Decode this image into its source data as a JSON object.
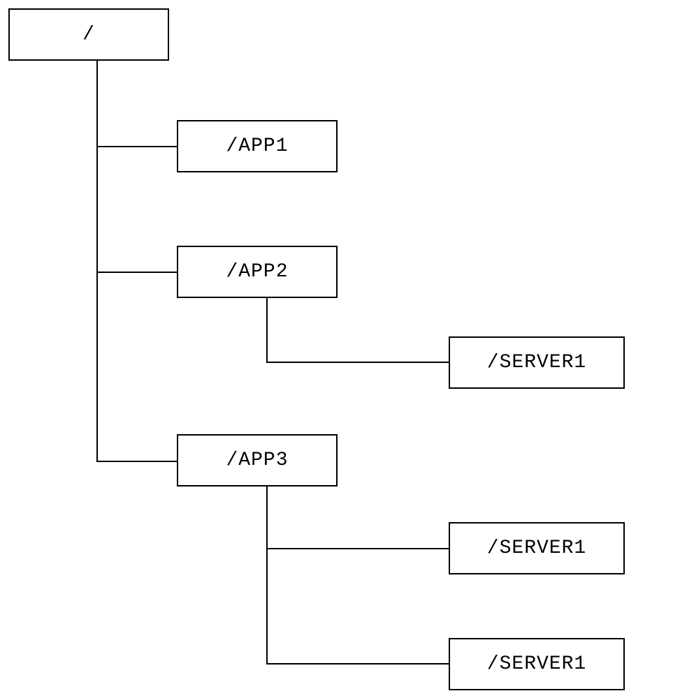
{
  "diagram": {
    "root": {
      "label": "/"
    },
    "level1": {
      "app1": {
        "label": "/APP1"
      },
      "app2": {
        "label": "/APP2"
      },
      "app3": {
        "label": "/APP3"
      }
    },
    "level2": {
      "app2_server1": {
        "label": "/SERVER1"
      },
      "app3_server1": {
        "label": "/SERVER1"
      },
      "app3_server2": {
        "label": "/SERVER1"
      }
    }
  }
}
